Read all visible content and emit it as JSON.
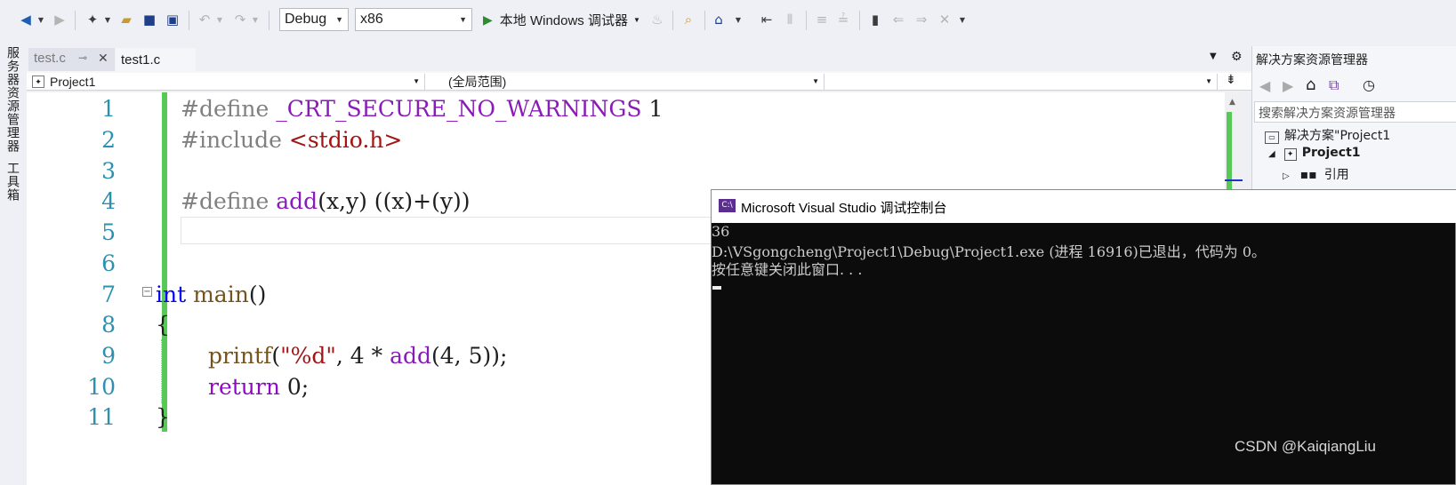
{
  "toolbar": {
    "config": "Debug",
    "platform": "x86",
    "run_label": "本地 Windows 调试器"
  },
  "left_rail": {
    "server_explorer": "服务器资源管理器",
    "toolbox": "工具箱"
  },
  "tabs": [
    {
      "label": "test.c"
    },
    {
      "label": "test1.c"
    }
  ],
  "navbar": {
    "project": "Project1",
    "scope": "(全局范围)",
    "member": ""
  },
  "editor": {
    "line_numbers": [
      "1",
      "2",
      "3",
      "4",
      "5",
      "6",
      "7",
      "8",
      "9",
      "10",
      "11"
    ],
    "lines": {
      "l1_directive": "#define",
      "l1_macro": " _CRT_SECURE_NO_WARNINGS",
      "l1_value": " 1",
      "l2_directive": "#include",
      "l2_header": " <stdio.h>",
      "l4_directive": "#define",
      "l4_macro": " add",
      "l4_rest": "(x,y) ((x)+(y))",
      "l7_kw": "int",
      "l7_fn": " main",
      "l7_rest": "()",
      "l8": "{",
      "l9_fn": "printf",
      "l9_open": "(",
      "l9_str": "\"%d\"",
      "l9_mid": ", 4 * ",
      "l9_macro": "add",
      "l9_end": "(4, 5));",
      "l10_kw": "return",
      "l10_rest": " 0;",
      "l11": "}"
    }
  },
  "solution_explorer": {
    "title": "解决方案资源管理器",
    "search_placeholder": "搜索解决方案资源管理器",
    "solution": "解决方案\"Project1",
    "project": "Project1",
    "references": "引用"
  },
  "console": {
    "title": "Microsoft Visual Studio 调试控制台",
    "icon_text": "C:\\",
    "lines": [
      "36",
      "D:\\VSgongcheng\\Project1\\Debug\\Project1.exe (进程 16916)已退出，代码为 0。",
      "按任意键关闭此窗口. . ."
    ]
  },
  "watermark": "CSDN @KaiqiangLiu"
}
